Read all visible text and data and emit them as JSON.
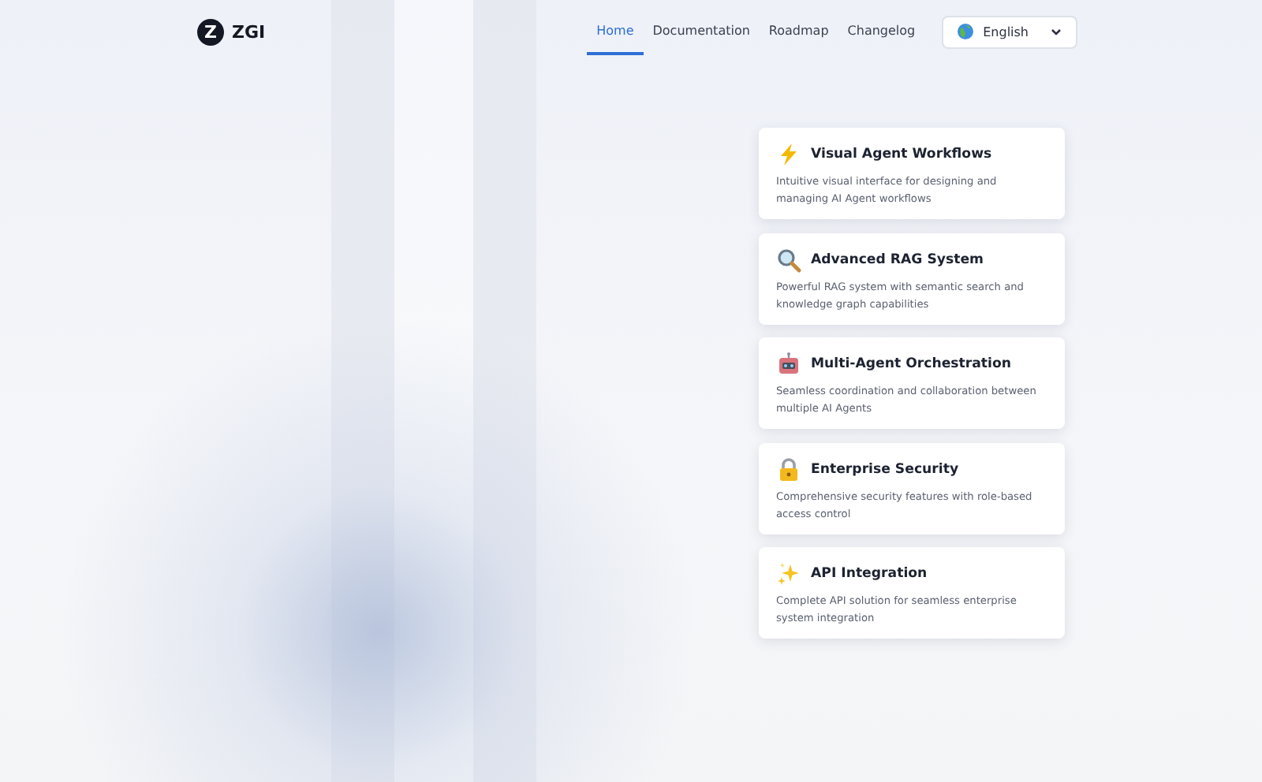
{
  "brand": {
    "name": "ZGI",
    "mark": "Z"
  },
  "nav": [
    {
      "label": "Home",
      "selected": true
    },
    {
      "label": "Documentation",
      "selected": false
    },
    {
      "label": "Roadmap",
      "selected": false
    },
    {
      "label": "Changelog",
      "selected": false
    }
  ],
  "language": {
    "value": "English"
  },
  "features": [
    {
      "title": "Visual Agent Workflows",
      "description": "Intuitive visual interface for designing and managing AI Agent workflows"
    },
    {
      "title": "Advanced RAG System",
      "description": "Powerful RAG system with semantic search and knowledge graph capabilities"
    },
    {
      "title": "Multi-Agent Orchestration",
      "description": "Seamless coordination and collaboration between multiple AI Agents"
    },
    {
      "title": "Enterprise Security",
      "description": "Comprehensive security features with role-based access control"
    },
    {
      "title": "API Integration",
      "description": "Complete API solution for seamless enterprise system integration"
    }
  ]
}
